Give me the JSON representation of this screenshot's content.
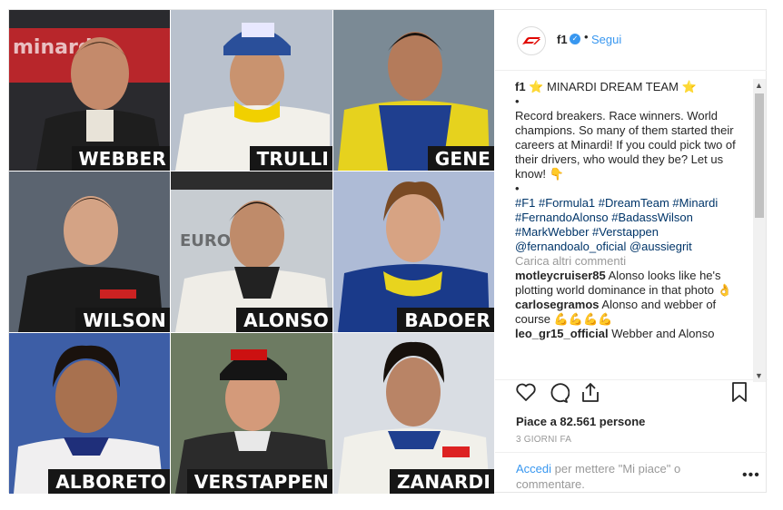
{
  "account": {
    "username": "f1",
    "dot": "•",
    "follow_label": "Segui"
  },
  "drivers": [
    {
      "name": "WEBBER",
      "bg": "#b8262b"
    },
    {
      "name": "TRULLI",
      "bg": "#b9c1cd"
    },
    {
      "name": "GENE",
      "bg": "#7b8a95"
    },
    {
      "name": "WILSON",
      "bg": "#5b6470"
    },
    {
      "name": "ALONSO",
      "bg": "#c7ccd1"
    },
    {
      "name": "BADOER",
      "bg": "#aebbd6"
    },
    {
      "name": "ALBORETO",
      "bg": "#3d5ea6"
    },
    {
      "name": "VERSTAPPEN",
      "bg": "#6d7b62"
    },
    {
      "name": "ZANARDI",
      "bg": "#d9dde3"
    }
  ],
  "caption": {
    "user": "f1",
    "title": "⭐ MINARDI DREAM TEAM ⭐",
    "bullet1": "•",
    "body": "Record breakers. Race winners. World champions. So many of them started their careers at Minardi! If you could pick two of their drivers, who would they be? Let us know! 👇",
    "bullet2": "•",
    "hashtags": "#F1 #Formula1 #DreamTeam #Minardi #FernandoAlonso #BadassWilson #MarkWebber #Verstappen @fernandoalo_oficial @aussiegrit"
  },
  "load_more": "Carica altri commenti",
  "comments": [
    {
      "user": "motleycruiser85",
      "text": "Alonso looks like he's plotting world dominance in that photo 👌"
    },
    {
      "user": "carlosegramos",
      "text": "Alonso and webber of course 💪💪💪💪"
    },
    {
      "user": "leo_gr15_official",
      "text": "Webber and Alonso"
    }
  ],
  "likes_text": "Piace a 82.561 persone",
  "time_text": "3 GIORNI FA",
  "add_comment": {
    "link": "Accedi",
    "rest": " per mettere \"Mi piace\" o commentare."
  },
  "colors": {
    "accent": "#3897f0",
    "f1_red": "#e10600"
  }
}
